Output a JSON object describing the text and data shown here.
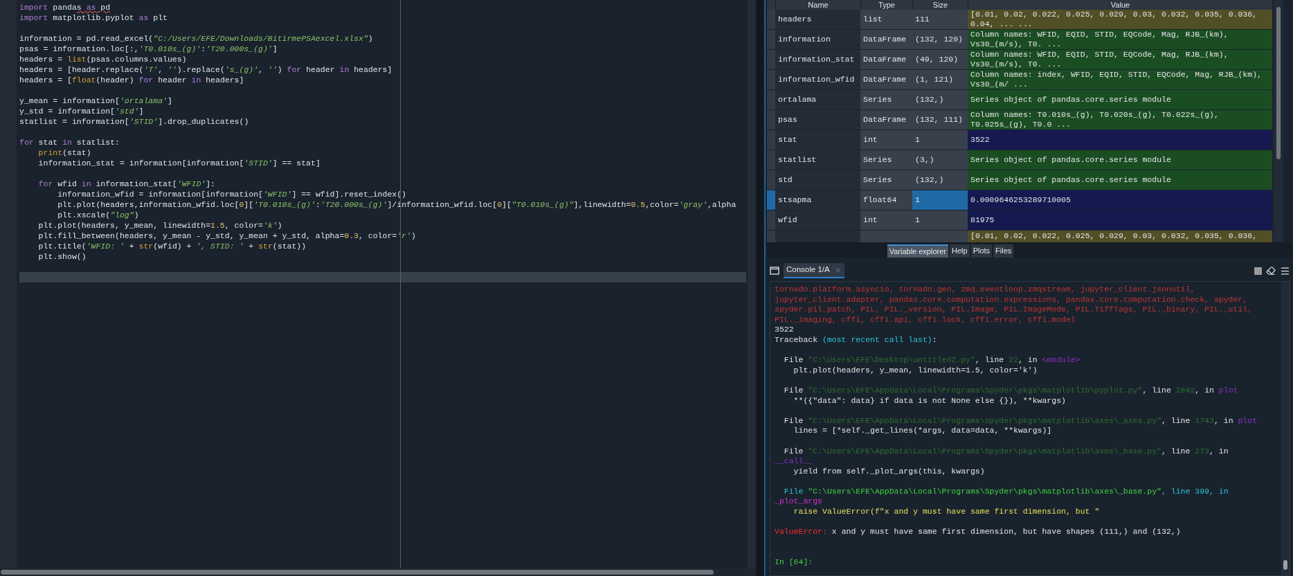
{
  "editor": {
    "lines": [
      {
        "kind": "code",
        "tokens": [
          {
            "kind": "kw",
            "text": "import"
          },
          {
            "kind": "p",
            "text": " panda"
          },
          {
            "kind": "p",
            "text": "s ",
            "squiggle": true
          },
          {
            "kind": "kw",
            "text": "as",
            "squiggle": true
          },
          {
            "kind": "p",
            "text": " pd",
            "squiggle": true
          }
        ]
      },
      {
        "kind": "code",
        "tokens": [
          {
            "kind": "kw",
            "text": "import"
          },
          {
            "kind": "p",
            "text": " matplotlib.pyplot "
          },
          {
            "kind": "kw",
            "text": "as"
          },
          {
            "kind": "p",
            "text": " plt"
          }
        ]
      },
      {
        "kind": "blank"
      },
      {
        "kind": "code",
        "tokens": [
          {
            "kind": "p",
            "text": "information = pd.read_excel("
          },
          {
            "kind": "s",
            "text": "\"C:/Users/EFE/Downloads/BitirmePSAexcel.xlsx\""
          },
          {
            "kind": "p",
            "text": ")"
          }
        ]
      },
      {
        "kind": "code",
        "tokens": [
          {
            "kind": "p",
            "text": "psas = information.loc[:,"
          },
          {
            "kind": "s",
            "text": "'T0.010s_(g)'"
          },
          {
            "kind": "p",
            "text": ":"
          },
          {
            "kind": "s",
            "text": "'T20.000s_(g)'"
          },
          {
            "kind": "p",
            "text": "]"
          }
        ]
      },
      {
        "kind": "code",
        "tokens": [
          {
            "kind": "p",
            "text": "headers = "
          },
          {
            "kind": "b",
            "text": "list"
          },
          {
            "kind": "p",
            "text": "(psas.columns.values)"
          }
        ]
      },
      {
        "kind": "code",
        "tokens": [
          {
            "kind": "p",
            "text": "headers = [header.replace("
          },
          {
            "kind": "s",
            "text": "'T'"
          },
          {
            "kind": "p",
            "text": ", "
          },
          {
            "kind": "s",
            "text": "''"
          },
          {
            "kind": "p",
            "text": ").replace("
          },
          {
            "kind": "s",
            "text": "'s_(g)'"
          },
          {
            "kind": "p",
            "text": ", "
          },
          {
            "kind": "s",
            "text": "''"
          },
          {
            "kind": "p",
            "text": ") "
          },
          {
            "kind": "kw",
            "text": "for"
          },
          {
            "kind": "p",
            "text": " header "
          },
          {
            "kind": "kw",
            "text": "in"
          },
          {
            "kind": "p",
            "text": " headers]"
          }
        ]
      },
      {
        "kind": "code",
        "tokens": [
          {
            "kind": "p",
            "text": "headers = ["
          },
          {
            "kind": "b",
            "text": "float"
          },
          {
            "kind": "p",
            "text": "(header) "
          },
          {
            "kind": "kw",
            "text": "for"
          },
          {
            "kind": "p",
            "text": " header "
          },
          {
            "kind": "kw",
            "text": "in"
          },
          {
            "kind": "p",
            "text": " headers]"
          }
        ]
      },
      {
        "kind": "blank"
      },
      {
        "kind": "code",
        "tokens": [
          {
            "kind": "p",
            "text": "y_mean = information["
          },
          {
            "kind": "s",
            "text": "'ortalama'"
          },
          {
            "kind": "p",
            "text": "]"
          }
        ]
      },
      {
        "kind": "code",
        "tokens": [
          {
            "kind": "p",
            "text": "y_std = information["
          },
          {
            "kind": "s",
            "text": "'std'"
          },
          {
            "kind": "p",
            "text": "]"
          }
        ]
      },
      {
        "kind": "code",
        "tokens": [
          {
            "kind": "p",
            "text": "statlist = information["
          },
          {
            "kind": "s",
            "text": "'STID'"
          },
          {
            "kind": "p",
            "text": "].drop_duplicates()"
          }
        ]
      },
      {
        "kind": "blank"
      },
      {
        "kind": "code",
        "tokens": [
          {
            "kind": "kw",
            "text": "for"
          },
          {
            "kind": "p",
            "text": " stat "
          },
          {
            "kind": "kw",
            "text": "in"
          },
          {
            "kind": "p",
            "text": " statlist:"
          }
        ]
      },
      {
        "kind": "code",
        "tokens": [
          {
            "kind": "b",
            "text": "    print"
          },
          {
            "kind": "p",
            "text": "(stat)"
          }
        ]
      },
      {
        "kind": "code",
        "tokens": [
          {
            "kind": "p",
            "text": "    information_stat = information[information["
          },
          {
            "kind": "s",
            "text": "'STID'"
          },
          {
            "kind": "p",
            "text": "] == stat]"
          }
        ]
      },
      {
        "kind": "blank"
      },
      {
        "kind": "code",
        "tokens": [
          {
            "kind": "kw",
            "text": "    for"
          },
          {
            "kind": "p",
            "text": " wfid "
          },
          {
            "kind": "kw",
            "text": "in"
          },
          {
            "kind": "p",
            "text": " information_stat["
          },
          {
            "kind": "s",
            "text": "'WFID'"
          },
          {
            "kind": "p",
            "text": "]:"
          }
        ]
      },
      {
        "kind": "code",
        "tokens": [
          {
            "kind": "p",
            "text": "        information_wfid = information[information["
          },
          {
            "kind": "s",
            "text": "'WFID'"
          },
          {
            "kind": "p",
            "text": "] == wfid].reset_index()"
          }
        ]
      },
      {
        "kind": "code",
        "tokens": [
          {
            "kind": "p",
            "text": "        plt.plot(headers,information_wfid.loc["
          },
          {
            "kind": "n",
            "text": "0"
          },
          {
            "kind": "p",
            "text": "]["
          },
          {
            "kind": "s",
            "text": "'T0.010s_(g)'"
          },
          {
            "kind": "p",
            "text": ":"
          },
          {
            "kind": "s",
            "text": "'T20.000s_(g)'"
          },
          {
            "kind": "p",
            "text": "]/information_wfid.loc["
          },
          {
            "kind": "n",
            "text": "0"
          },
          {
            "kind": "p",
            "text": "]["
          },
          {
            "kind": "s",
            "text": "\"T0.010s_(g)\""
          },
          {
            "kind": "p",
            "text": "],linewidth="
          },
          {
            "kind": "n",
            "text": "0.5"
          },
          {
            "kind": "p",
            "text": ",color="
          },
          {
            "kind": "s",
            "text": "'gray'"
          },
          {
            "kind": "p",
            "text": ",alpha"
          }
        ]
      },
      {
        "kind": "code",
        "tokens": [
          {
            "kind": "p",
            "text": "        plt.xscale("
          },
          {
            "kind": "s",
            "text": "\"log\""
          },
          {
            "kind": "p",
            "text": ")"
          }
        ]
      },
      {
        "kind": "code",
        "tokens": [
          {
            "kind": "p",
            "text": "    plt.plot(headers, y_mean, linewidth="
          },
          {
            "kind": "n",
            "text": "1.5"
          },
          {
            "kind": "p",
            "text": ", color="
          },
          {
            "kind": "s",
            "text": "'k'"
          },
          {
            "kind": "p",
            "text": ")"
          }
        ]
      },
      {
        "kind": "code",
        "tokens": [
          {
            "kind": "p",
            "text": "    plt.fill_between(headers, y_mean - y_std, y_mean + y_std, alpha="
          },
          {
            "kind": "n",
            "text": "0.3"
          },
          {
            "kind": "p",
            "text": ", color="
          },
          {
            "kind": "s",
            "text": "'r'"
          },
          {
            "kind": "p",
            "text": ")"
          }
        ]
      },
      {
        "kind": "code",
        "tokens": [
          {
            "kind": "p",
            "text": "    plt.title("
          },
          {
            "kind": "s",
            "text": "'WFID: '"
          },
          {
            "kind": "p",
            "text": " + "
          },
          {
            "kind": "b",
            "text": "str"
          },
          {
            "kind": "p",
            "text": "(wfid) + "
          },
          {
            "kind": "s",
            "text": "', STID: '"
          },
          {
            "kind": "p",
            "text": " + "
          },
          {
            "kind": "b",
            "text": "str"
          },
          {
            "kind": "p",
            "text": "(stat))"
          }
        ]
      },
      {
        "kind": "code",
        "tokens": [
          {
            "kind": "p",
            "text": "    plt.show()"
          }
        ]
      },
      {
        "kind": "blank"
      },
      {
        "kind": "current"
      }
    ]
  },
  "variable_explorer": {
    "columns": [
      "Name",
      "Type",
      "Size",
      "Value"
    ],
    "rows": [
      {
        "name": "headers",
        "type": "list",
        "size": "111",
        "value": "[0.01, 0.02, 0.022, 0.025, 0.029, 0.03, 0.032, 0.035, 0.036, 0.04, ... ...",
        "color": "#524f26",
        "selected": false
      },
      {
        "name": "information",
        "type": "DataFrame",
        "size": "(132, 120)",
        "value": "Column names: WFID, EQID, STID, EQCode, Mag, RJB_(km), Vs30_(m/s), T0. ...",
        "color": "#1b4d23",
        "selected": false
      },
      {
        "name": "information_stat",
        "type": "DataFrame",
        "size": "(49, 120)",
        "value": "Column names: WFID, EQID, STID, EQCode, Mag, RJB_(km), Vs30_(m/s), T0. ...",
        "color": "#1b4d23",
        "selected": false
      },
      {
        "name": "information_wfid",
        "type": "DataFrame",
        "size": "(1, 121)",
        "value": "Column names: index, WFID, EQID, STID, EQCode, Mag, RJB_(km), Vs30_(m/ ...",
        "color": "#1b4d23",
        "selected": false
      },
      {
        "name": "ortalama",
        "type": "Series",
        "size": "(132,)",
        "value": "Series object of pandas.core.series module",
        "color": "#1b4d23",
        "selected": false
      },
      {
        "name": "psas",
        "type": "DataFrame",
        "size": "(132, 111)",
        "value": "Column names: T0.010s_(g), T0.020s_(g), T0.022s_(g), T0.025s_(g), T0.0 ...",
        "color": "#1b4d23",
        "selected": false
      },
      {
        "name": "stat",
        "type": "int",
        "size": "1",
        "value": "3522",
        "color": "#15194f",
        "selected": false
      },
      {
        "name": "statlist",
        "type": "Series",
        "size": "(3,)",
        "value": "Series object of pandas.core.series module",
        "color": "#1b4d23",
        "selected": false
      },
      {
        "name": "std",
        "type": "Series",
        "size": "(132,)",
        "value": "Series object of pandas.core.series module",
        "color": "#1b4d23",
        "selected": false
      },
      {
        "name": "stsapma",
        "type": "float64",
        "size": "1",
        "value": "0.0009646253289710005",
        "color": "#15194f",
        "selected": true
      },
      {
        "name": "wfid",
        "type": "int",
        "size": "1",
        "value": "81975",
        "color": "#15194f",
        "selected": false
      },
      {
        "value": "[0.01, 0.02, 0.022, 0.025, 0.029, 0.03, 0.032, 0.035, 0.036,",
        "color": "#524f26",
        "selected": false
      }
    ],
    "tabs": [
      {
        "label": "Variable explorer",
        "selected": true
      },
      {
        "label": "Help",
        "selected": false
      },
      {
        "label": "Plots",
        "selected": false
      },
      {
        "label": "Files",
        "selected": false
      }
    ]
  },
  "console": {
    "tabs": [
      {
        "label": "Console 1/A",
        "selected": true
      }
    ],
    "lines": [
      {
        "kind": "code",
        "tokens": [
          {
            "kind": "err",
            "text": "tornado.platform.asyncio, tornado.gen, zmq.eventloop.zmqstream, jupyter_client.jsonutil,"
          }
        ]
      },
      {
        "kind": "code",
        "tokens": [
          {
            "kind": "err",
            "text": "jupyter_client.adapter, pandas.core.computation.expressions, pandas.core.computation.check, spyder,"
          }
        ]
      },
      {
        "kind": "code",
        "tokens": [
          {
            "kind": "err",
            "text": "spyder.pil_patch, PIL, PIL._version, PIL.Image, PIL.ImageMode, PIL.TiffTags, PIL._binary, PIL._util,"
          }
        ]
      },
      {
        "kind": "code",
        "tokens": [
          {
            "kind": "err",
            "text": "PIL._imaging, cffi, cffi.api, cffi.lock, cffi.error, cffi.model"
          }
        ]
      },
      {
        "kind": "code",
        "tokens": [
          {
            "kind": "p",
            "text": "3522"
          }
        ]
      },
      {
        "kind": "code",
        "tokens": [
          {
            "kind": "p",
            "text": "Traceback "
          },
          {
            "kind": "hl",
            "text": "(most recent call last)"
          },
          {
            "kind": "p",
            "text": ":"
          }
        ]
      },
      {
        "kind": "blank"
      },
      {
        "kind": "code",
        "tokens": [
          {
            "kind": "p",
            "text": "  File "
          },
          {
            "kind": "path",
            "text": "\"C:\\Users\\EFE\\Desktop\\untitled2.py\""
          },
          {
            "kind": "p",
            "text": ", line "
          },
          {
            "kind": "num",
            "text": "22"
          },
          {
            "kind": "p",
            "text": ", in "
          },
          {
            "kind": "fn",
            "text": "<module>"
          }
        ]
      },
      {
        "kind": "code",
        "tokens": [
          {
            "kind": "p",
            "text": "    plt.plot(headers, y_mean, linewidth=1.5, color='k')"
          }
        ]
      },
      {
        "kind": "blank"
      },
      {
        "kind": "code",
        "tokens": [
          {
            "kind": "p",
            "text": "  File "
          },
          {
            "kind": "path",
            "text": "\"C:\\Users\\EFE\\AppData\\Local\\Programs\\Spyder\\pkgs\\matplotlib\\pyplot.py\""
          },
          {
            "kind": "p",
            "text": ", line "
          },
          {
            "kind": "num",
            "text": "2842"
          },
          {
            "kind": "p",
            "text": ", in "
          },
          {
            "kind": "fn",
            "text": "plot"
          }
        ]
      },
      {
        "kind": "code",
        "tokens": [
          {
            "kind": "p",
            "text": "    **({\"data\": data} if data is not None else {}), **kwargs)"
          }
        ]
      },
      {
        "kind": "blank"
      },
      {
        "kind": "code",
        "tokens": [
          {
            "kind": "p",
            "text": "  File "
          },
          {
            "kind": "path",
            "text": "\"C:\\Users\\EFE\\AppData\\Local\\Programs\\Spyder\\pkgs\\matplotlib\\axes\\_axes.py\""
          },
          {
            "kind": "p",
            "text": ", line "
          },
          {
            "kind": "num",
            "text": "1743"
          },
          {
            "kind": "p",
            "text": ", in "
          },
          {
            "kind": "fn",
            "text": "plot"
          }
        ]
      },
      {
        "kind": "code",
        "tokens": [
          {
            "kind": "p",
            "text": "    lines = [*self._get_lines(*args, data=data, **kwargs)]"
          }
        ]
      },
      {
        "kind": "blank"
      },
      {
        "kind": "code",
        "tokens": [
          {
            "kind": "p",
            "text": "  File "
          },
          {
            "kind": "path",
            "text": "\"C:\\Users\\EFE\\AppData\\Local\\Programs\\Spyder\\pkgs\\matplotlib\\axes\\_base.py\""
          },
          {
            "kind": "p",
            "text": ", line "
          },
          {
            "kind": "num",
            "text": "273"
          },
          {
            "kind": "p",
            "text": ", in"
          }
        ]
      },
      {
        "kind": "code",
        "tokens": [
          {
            "kind": "fn",
            "text": "__call__"
          }
        ]
      },
      {
        "kind": "code",
        "tokens": [
          {
            "kind": "p",
            "text": "    yield from self._plot_args(this, kwargs)"
          }
        ]
      },
      {
        "kind": "blank"
      },
      {
        "kind": "code",
        "tokens": [
          {
            "kind": "hl",
            "text": "  File "
          },
          {
            "kind": "bpath",
            "text": "\"C:\\Users\\EFE\\AppData\\Local\\Programs\\Spyder\\pkgs\\matplotlib\\axes\\_base.py\""
          },
          {
            "kind": "hl",
            "text": ", line 399, in"
          }
        ]
      },
      {
        "kind": "code",
        "tokens": [
          {
            "kind": "bfn",
            "text": "_plot_args"
          }
        ]
      },
      {
        "kind": "code",
        "tokens": [
          {
            "kind": "code",
            "text": "    raise ValueError(f\"x and y must have same first dimension, but \""
          }
        ]
      },
      {
        "kind": "blank"
      },
      {
        "kind": "code",
        "tokens": [
          {
            "kind": "exc",
            "text": "ValueError:"
          },
          {
            "kind": "p",
            "text": " x and y must have same first dimension, but have shapes (111,) and (132,)"
          }
        ]
      },
      {
        "kind": "blank"
      },
      {
        "kind": "blank"
      },
      {
        "kind": "code",
        "tokens": [
          {
            "kind": "prompt",
            "text": "In [64]:"
          }
        ]
      }
    ]
  }
}
